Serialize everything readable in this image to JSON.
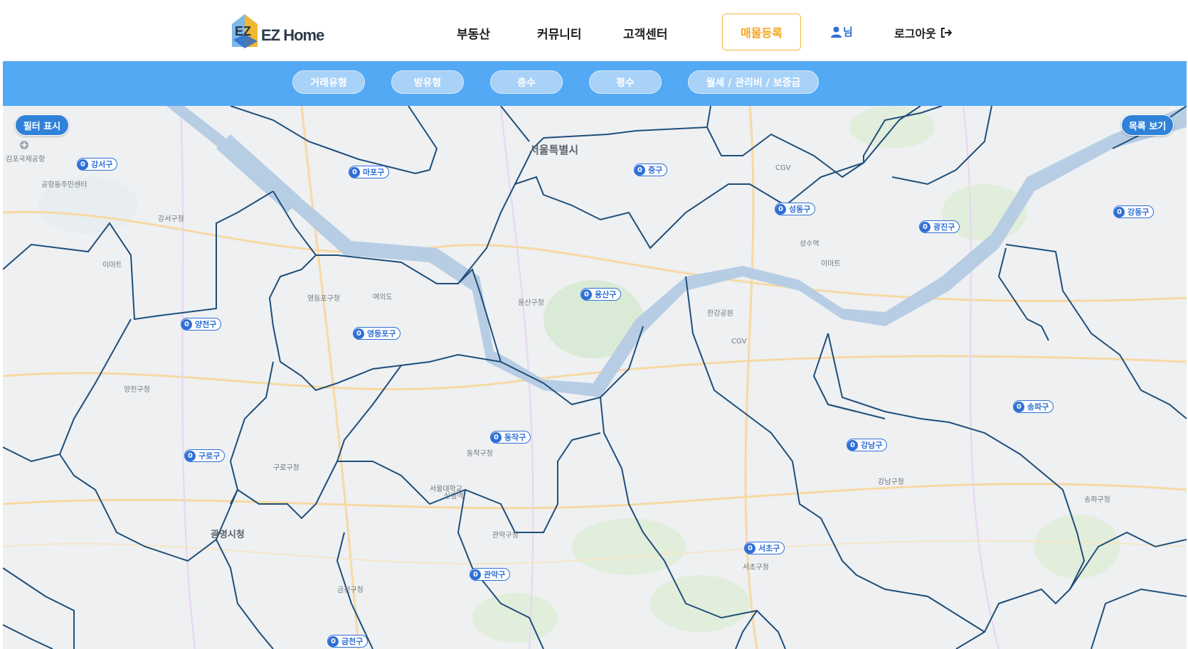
{
  "header": {
    "logo_text": "EZ Home",
    "nav": [
      "부동산",
      "커뮤니티",
      "고객센터"
    ],
    "register_label": "매물등록",
    "user_label": "님",
    "logout_label": "로그아웃"
  },
  "filters": [
    "거래유형",
    "방유형",
    "층수",
    "평수",
    "월세 / 관리비 / 보증금"
  ],
  "map": {
    "show_filter_label": "필터 표시",
    "list_view_label": "목록 보기",
    "city_label": "서울특별시",
    "districts": [
      {
        "name": "강서구",
        "count": "0"
      },
      {
        "name": "마포구",
        "count": "0"
      },
      {
        "name": "중구",
        "count": "0"
      },
      {
        "name": "성동구",
        "count": "0"
      },
      {
        "name": "광진구",
        "count": "0"
      },
      {
        "name": "강동구",
        "count": "0"
      },
      {
        "name": "양천구",
        "count": "0"
      },
      {
        "name": "영등포구",
        "count": "0"
      },
      {
        "name": "용산구",
        "count": "0"
      },
      {
        "name": "동작구",
        "count": "0"
      },
      {
        "name": "구로구",
        "count": "0"
      },
      {
        "name": "송파구",
        "count": "0"
      },
      {
        "name": "강남구",
        "count": "0"
      },
      {
        "name": "서초구",
        "count": "0"
      },
      {
        "name": "관악구",
        "count": "0"
      },
      {
        "name": "금천구",
        "count": "0"
      }
    ],
    "pois": [
      "서울특별시",
      "김포국제공항",
      "공항동주민센터",
      "강서구청",
      "양천구청",
      "영등포구청",
      "구로구청",
      "광명시청",
      "금천구청",
      "관악구청",
      "동작구청",
      "용산구청",
      "서울대학교",
      "성수역",
      "강남구청",
      "송파구청",
      "서초구청",
      "CGV",
      "이마트",
      "신림역",
      "여의도",
      "한강공원"
    ],
    "colors": {
      "boundary": "#1f4e79",
      "river": "#b7cde4",
      "marker": "#2f6fd6",
      "filterbar": "#53a9f4",
      "accent": "#f5a623"
    }
  }
}
